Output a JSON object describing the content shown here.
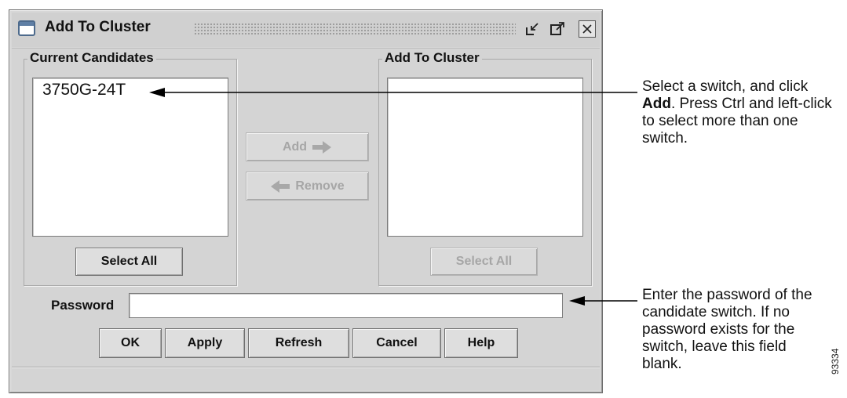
{
  "window": {
    "title": "Add To Cluster",
    "title_icon": "window-icon",
    "controls": {
      "minimize_icon": "minimize-icon",
      "maximize_icon": "maximize-icon",
      "close_icon": "close-icon"
    }
  },
  "left_panel": {
    "title": "Current Candidates",
    "items": [
      "3750G-24T"
    ],
    "select_all_label": "Select All"
  },
  "right_panel": {
    "title": "Add To Cluster",
    "items": [],
    "select_all_label": "Select All"
  },
  "middle": {
    "add_label": "Add",
    "remove_label": "Remove"
  },
  "password": {
    "label": "Password",
    "value": ""
  },
  "buttons": {
    "ok": "OK",
    "apply": "Apply",
    "refresh": "Refresh",
    "cancel": "Cancel",
    "help": "Help"
  },
  "callouts": {
    "select_pre": "Select a switch, and click ",
    "select_bold": "Add",
    "select_post": ". Press Ctrl and left-click to select more than one switch.",
    "password_text": "Enter the password of the candidate switch. If no password exists for the switch, leave this field blank."
  },
  "figure_id": "93334",
  "colors": {
    "frame_bg": "#d4d4d4",
    "disabled_text": "#a6a6a6",
    "border": "#6f6f6f"
  }
}
